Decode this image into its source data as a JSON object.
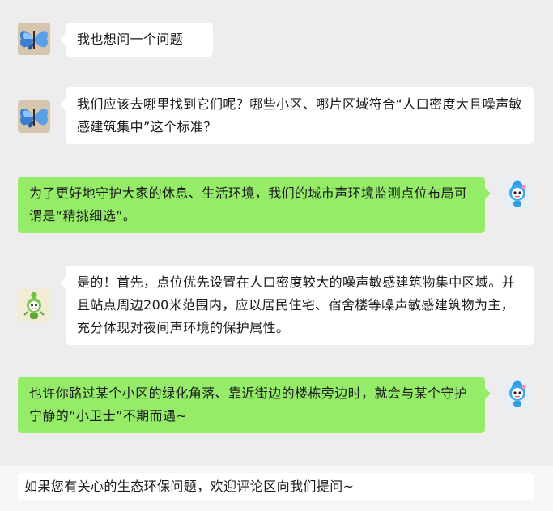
{
  "messages": [
    {
      "side": "left",
      "avatar": "butterfly-avatar-icon",
      "text": "我也想问一个问题"
    },
    {
      "side": "left",
      "avatar": "butterfly-avatar-icon",
      "text": "我们应该去哪里找到它们呢？哪些小区、哪片区域符合“人口密度大且噪声敏感建筑集中”这个标准？"
    },
    {
      "side": "right",
      "avatar": "blue-mascot-avatar-icon",
      "text": "为了更好地守护大家的休息、生活环境，我们的城市声环境监测点位布局可谓是“精挑细选”。"
    },
    {
      "side": "left",
      "avatar": "green-mascot-avatar-icon",
      "text": "是的！首先，点位优先设置在人口密度较大的噪声敏感建筑物集中区域。并且站点周边200米范围内，应以居民住宅、宿舍楼等噪声敏感建筑物为主，充分体现对夜间声环境的保护属性。"
    },
    {
      "side": "right",
      "avatar": "blue-mascot-avatar-icon",
      "text": "也许你路过某个小区的绿化角落、靠近街边的楼栋旁边时，就会与某个守护宁静的“小卫士”不期而遇~"
    }
  ],
  "footer": {
    "text": "如果您有关心的生态环保问题，欢迎评论区向我们提问~"
  },
  "colors": {
    "background": "#ededed",
    "incoming_bubble": "#ffffff",
    "outgoing_bubble": "#95ec69"
  }
}
